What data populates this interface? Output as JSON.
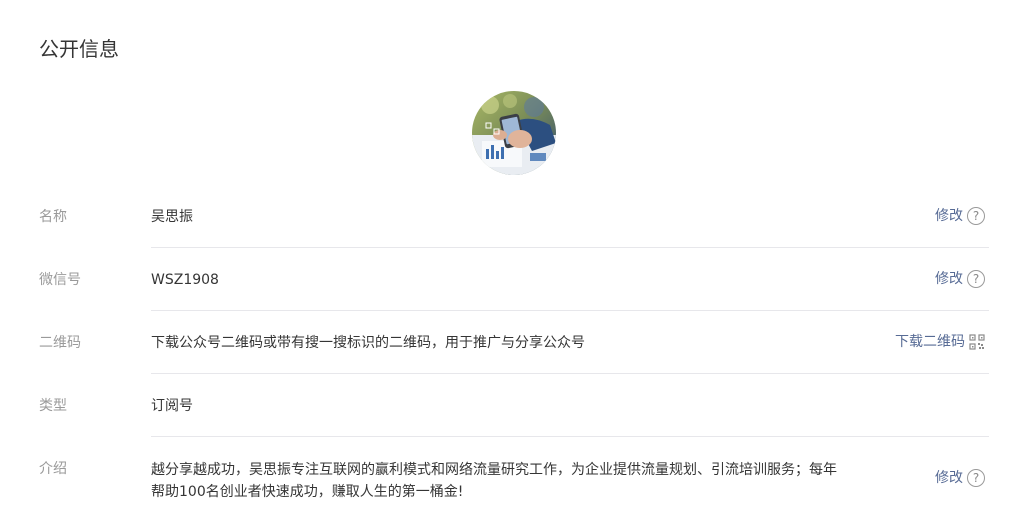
{
  "page": {
    "title": "公开信息"
  },
  "avatar": {
    "icon": "avatar-image"
  },
  "rows": [
    {
      "label": "名称",
      "value": "吴思振",
      "action": "修改",
      "action_icon": "help-icon"
    },
    {
      "label": "微信号",
      "value": "WSZ1908",
      "action": "修改",
      "action_icon": "help-icon"
    },
    {
      "label": "二维码",
      "value": "下载公众号二维码或带有搜一搜标识的二维码，用于推广与分享公众号",
      "action": "下载二维码",
      "action_icon": "qr-code-icon"
    },
    {
      "label": "类型",
      "value": "订阅号"
    },
    {
      "label": "介绍",
      "value_lines": [
        "越分享越成功，吴思振专注互联网的赢利模式和网络流量研究工作，为企业提供流量规划、引流培训服务；每年",
        "帮助100名创业者快速成功，赚取人生的第一桶金!"
      ],
      "action": "修改",
      "action_icon": "help-icon"
    }
  ],
  "colors": {
    "link": "#576b95",
    "label": "#9a9a9a",
    "text": "#353535",
    "divider": "#e7e7eb"
  }
}
